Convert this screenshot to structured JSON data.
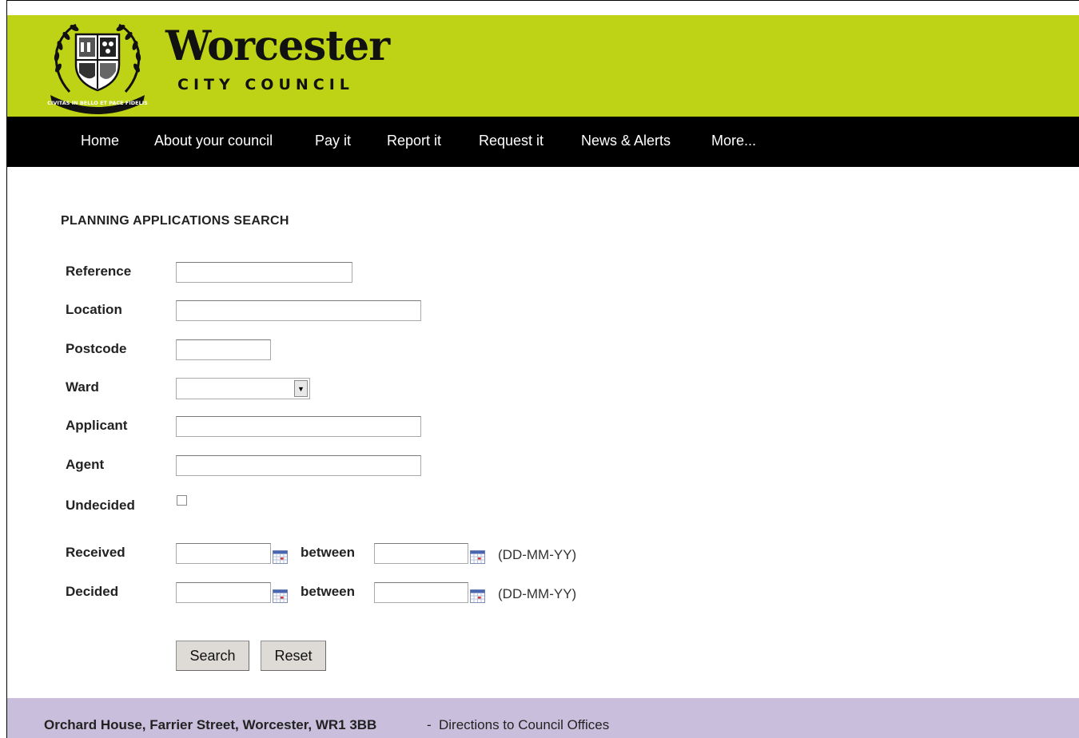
{
  "header": {
    "title": "Worcester",
    "subtitle": "CITY COUNCIL",
    "crest_motto": "CIVITAS IN BELLO ET PACE FIDELIS",
    "colors": {
      "header_bg": "#bfd316",
      "nav_bg": "#000000",
      "footer_bg": "#c9bfdc"
    }
  },
  "nav": {
    "items": [
      {
        "label": "Home"
      },
      {
        "label": "About your council"
      },
      {
        "label": "Pay it"
      },
      {
        "label": "Report it"
      },
      {
        "label": "Request it"
      },
      {
        "label": "News & Alerts"
      },
      {
        "label": "More..."
      }
    ]
  },
  "form": {
    "heading": "PLANNING APPLICATIONS SEARCH",
    "reference_label": "Reference",
    "reference_value": "",
    "location_label": "Location",
    "location_value": "",
    "postcode_label": "Postcode",
    "postcode_value": "",
    "ward_label": "Ward",
    "ward_value": "",
    "applicant_label": "Applicant",
    "applicant_value": "",
    "agent_label": "Agent",
    "agent_value": "",
    "undecided_label": "Undecided",
    "undecided_checked": false,
    "received_label": "Received",
    "decided_label": "Decided",
    "between_label": "between",
    "date_format": "(DD-MM-YY)",
    "calendar_icon": "calendar-icon",
    "search_label": "Search",
    "reset_label": "Reset"
  },
  "footer": {
    "address": "Orchard House, Farrier Street, Worcester, WR1 3BB",
    "separator": "-",
    "directions_link": "Directions to Council Offices"
  }
}
